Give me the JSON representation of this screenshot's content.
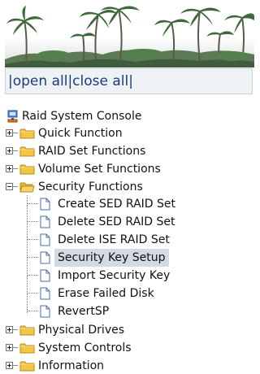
{
  "expander": {
    "bar_start": "|",
    "open_all": "open all",
    "sep": "|",
    "close_all": "close all",
    "bar_end": "|"
  },
  "tree": {
    "root": "Raid System Console",
    "quick_function": "Quick Function",
    "raid_set_functions": "RAID Set Functions",
    "volume_set_functions": "Volume Set Functions",
    "security_functions": "Security Functions",
    "security_children": [
      "Create SED RAID Set",
      "Delete SED RAID Set",
      "Delete ISE RAID Set",
      "Security Key Setup",
      "Import Security Key",
      "Erase Failed Disk",
      "RevertSP"
    ],
    "physical_drives": "Physical Drives",
    "system_controls": "System Controls",
    "information": "Information",
    "selected_item": "Security Key Setup"
  },
  "colors": {
    "link": "#1f3a7a",
    "folder": "#f4c542",
    "selected_bg": "#d4dae3"
  },
  "icons": {
    "root": "computer-icon",
    "folder": "folder-icon",
    "page": "page-icon"
  }
}
